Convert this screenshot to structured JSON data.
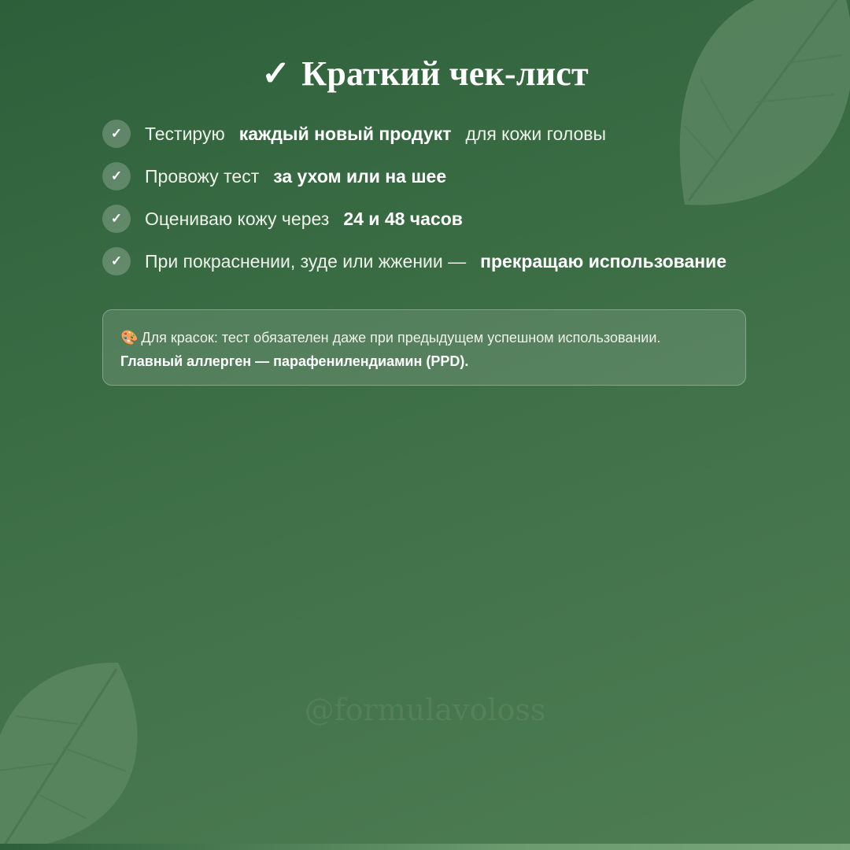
{
  "title": {
    "mark": "✓",
    "text": "Краткий чек-лист"
  },
  "checklist": [
    {
      "check": "✓",
      "lead": "Тестирую",
      "bold": "каждый новый продукт",
      "trail": "для кожи головы"
    },
    {
      "check": "✓",
      "lead": "Провожу тест",
      "bold": "за ухом или на шее",
      "trail": ""
    },
    {
      "check": "✓",
      "lead": "Оцениваю кожу через",
      "bold": "24 и 48 часов",
      "trail": ""
    },
    {
      "check": "✓",
      "lead": "При покраснении, зуде или жжении —",
      "bold": "прекращаю использование",
      "trail": ""
    }
  ],
  "note": {
    "icon": "🎨",
    "text": "Для красок: тест обязателен даже при предыдущем успешном использовании.",
    "bold": "Главный аллерген — парафенилендиамин (PPD)."
  },
  "watermark": "@formulavoloss",
  "colors": {
    "background": "#3a6c44",
    "leaf": "#5a8660",
    "text": "#eef2ea"
  }
}
